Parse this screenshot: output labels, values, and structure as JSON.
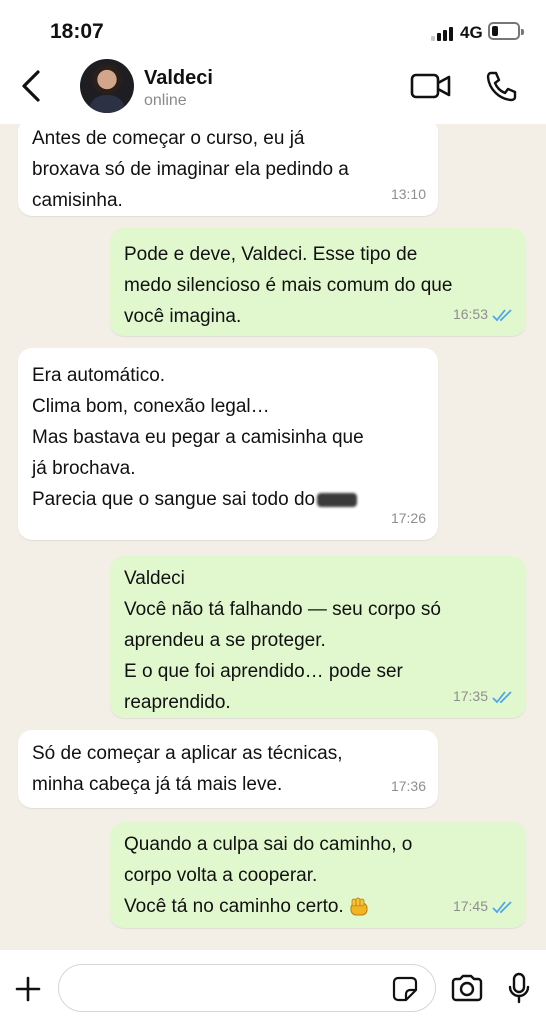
{
  "status_bar": {
    "time": "18:07",
    "network": "4G"
  },
  "header": {
    "contact_name": "Valdeci",
    "contact_status": "online"
  },
  "messages": [
    {
      "direction": "incoming",
      "lines": [
        "Antes de começar o curso, eu já",
        "broxava só de imaginar ela pedindo a",
        "camisinha."
      ],
      "time": "13:10"
    },
    {
      "direction": "outgoing",
      "lines": [
        "Pode e deve, Valdeci. Esse tipo de",
        "medo silencioso é mais comum do que",
        "você imagina."
      ],
      "time": "16:53",
      "status": "read"
    },
    {
      "direction": "incoming",
      "lines": [
        "Era automático.",
        "Clima bom, conexão legal…",
        "Mas bastava eu pegar a camisinha que",
        "já brochava.",
        "Parecia que o sangue sai todo do"
      ],
      "time": "17:26",
      "censored_last_word": true
    },
    {
      "direction": "outgoing",
      "lines": [
        "Valdeci",
        "Você não tá falhando — seu corpo só",
        "aprendeu a se proteger.",
        "E o que foi aprendido… pode ser",
        "reaprendido."
      ],
      "time": "17:35",
      "status": "read"
    },
    {
      "direction": "incoming",
      "lines": [
        "Só de começar a aplicar as técnicas,",
        "minha cabeça já tá mais leve."
      ],
      "time": "17:36"
    },
    {
      "direction": "outgoing",
      "lines": [
        "Quando a culpa sai do caminho, o",
        "corpo volta a cooperar.",
        "Você tá no caminho certo."
      ],
      "time": "17:45",
      "status": "read",
      "emoji": "raised-fist-emoji"
    }
  ],
  "colors": {
    "incoming_bubble": "#ffffff",
    "outgoing_bubble": "#e1f8cf",
    "chat_background": "#f3efe7",
    "read_ticks": "#4fa6e8",
    "meta_text": "#8e8e8e"
  },
  "icons": {
    "back": "chevron-left-icon",
    "video": "video-camera-icon",
    "call": "phone-icon",
    "plus": "plus-icon",
    "sticker": "sticker-icon",
    "camera": "camera-icon",
    "mic": "microphone-icon"
  },
  "composer": {
    "placeholder": ""
  }
}
